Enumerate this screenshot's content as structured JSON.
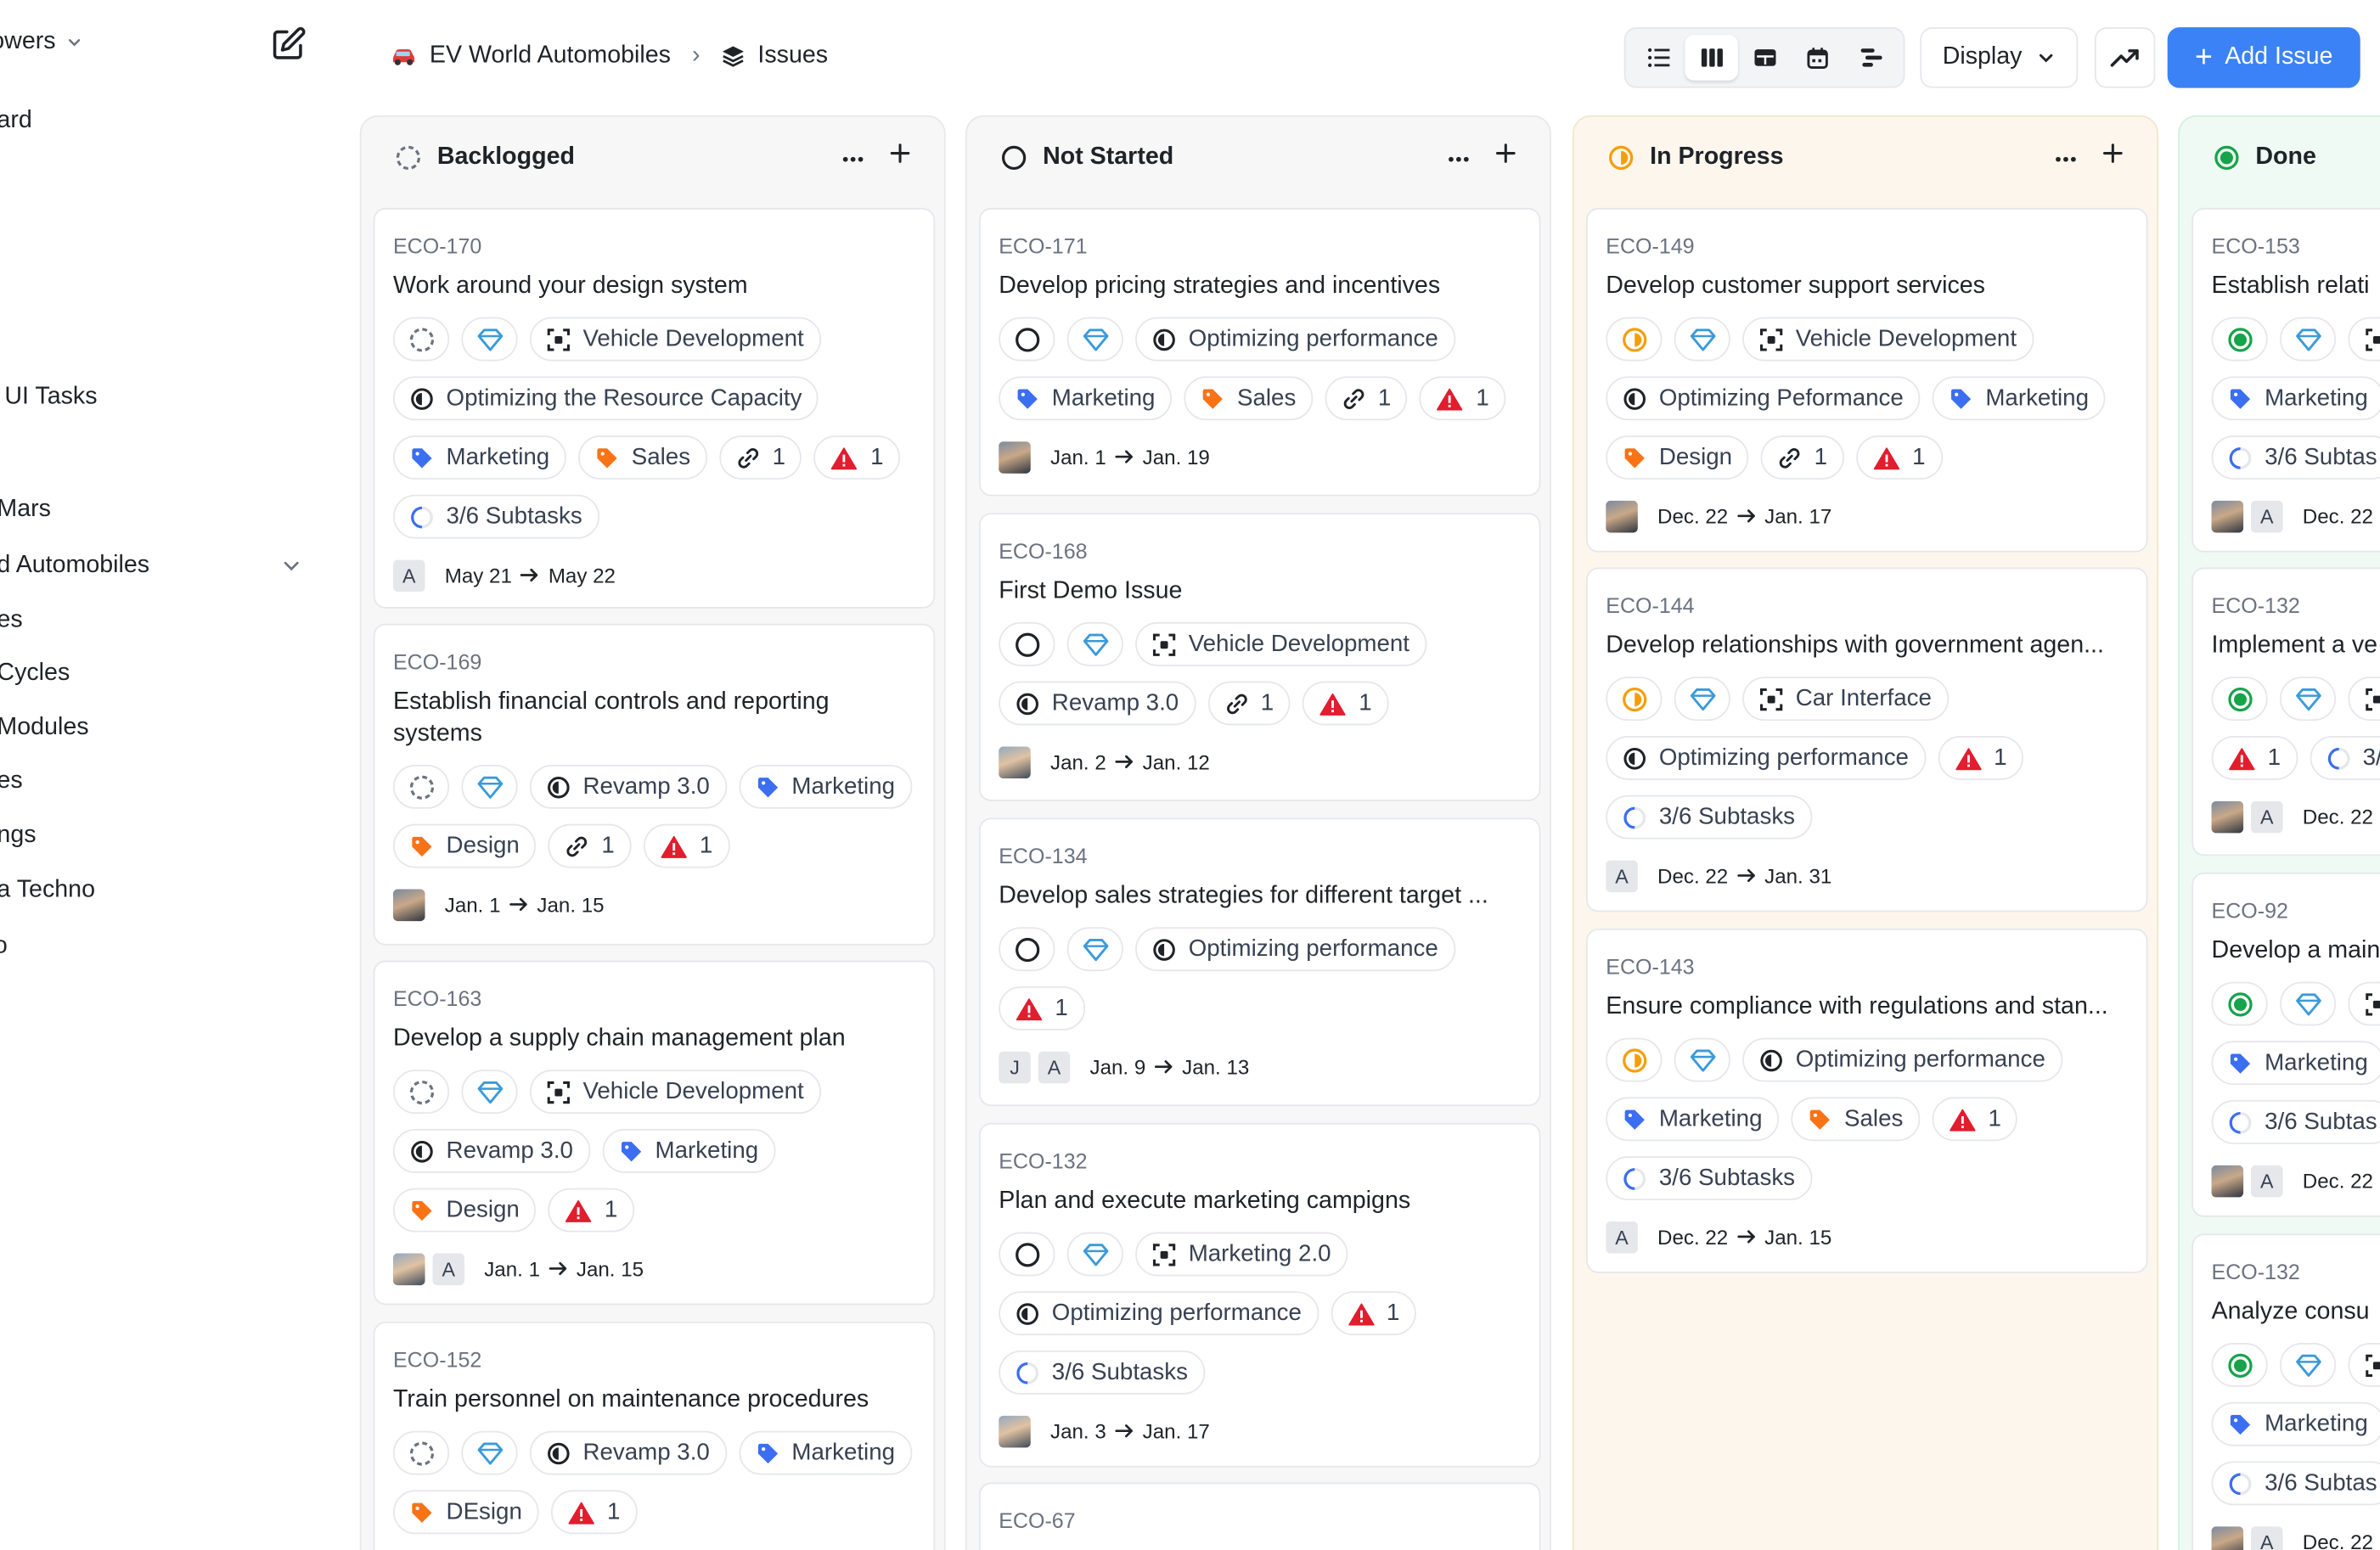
{
  "sidebar": {
    "workspace": "owers",
    "items": [
      "ard",
      "UI Tasks",
      "Mars",
      "d Automobiles",
      "es",
      "Cycles",
      "Modules",
      "es",
      "ngs",
      "a Techno",
      "o"
    ]
  },
  "header": {
    "project": "EV World Automobiles",
    "page": "Issues",
    "display_label": "Display",
    "add_label": "Add Issue",
    "accent_color": "#3b82f6"
  },
  "board": {
    "columns": [
      {
        "title": "Backlogged",
        "status": "backlog",
        "cards": [
          {
            "id": "ECO-170",
            "title": "Work around your design system",
            "rows": [
              [
                {
                  "t": "status"
                },
                {
                  "t": "prio"
                },
                {
                  "t": "module",
                  "l": "Vehicle Development"
                }
              ],
              [
                {
                  "t": "cycle",
                  "l": "Optimizing the Resource Capacity"
                }
              ],
              [
                {
                  "t": "label-blue",
                  "l": "Marketing"
                },
                {
                  "t": "label-orange",
                  "l": "Sales"
                },
                {
                  "t": "link",
                  "l": "1"
                },
                {
                  "t": "alert",
                  "l": "1"
                }
              ],
              [
                {
                  "t": "subtask",
                  "l": "3/6 Subtasks"
                }
              ]
            ],
            "avatars": [
              "A"
            ],
            "date": [
              "May 21",
              "May 22"
            ]
          },
          {
            "id": "ECO-169",
            "title": "Establish financial controls and reporting systems",
            "rows": [
              [
                {
                  "t": "status"
                },
                {
                  "t": "prio"
                },
                {
                  "t": "cycle",
                  "l": "Revamp 3.0"
                },
                {
                  "t": "label-blue",
                  "l": "Marketing"
                }
              ],
              [
                {
                  "t": "label-orange",
                  "l": "Design"
                },
                {
                  "t": "link",
                  "l": "1"
                },
                {
                  "t": "alert",
                  "l": "1"
                }
              ]
            ],
            "avatars": [
              "ph"
            ],
            "date": [
              "Jan. 1",
              "Jan. 15"
            ]
          },
          {
            "id": "ECO-163",
            "title": "Develop a supply chain management plan",
            "rows": [
              [
                {
                  "t": "status"
                },
                {
                  "t": "prio"
                },
                {
                  "t": "module",
                  "l": "Vehicle Development"
                }
              ],
              [
                {
                  "t": "cycle",
                  "l": "Revamp 3.0"
                },
                {
                  "t": "label-blue",
                  "l": "Marketing"
                }
              ],
              [
                {
                  "t": "label-orange",
                  "l": "Design"
                },
                {
                  "t": "alert",
                  "l": "1"
                }
              ]
            ],
            "avatars": [
              "ph2",
              "A"
            ],
            "date": [
              "Jan. 1",
              "Jan. 15"
            ]
          },
          {
            "id": "ECO-152",
            "title": "Train personnel on maintenance procedures",
            "rows": [
              [
                {
                  "t": "status"
                },
                {
                  "t": "prio"
                },
                {
                  "t": "cycle",
                  "l": "Revamp 3.0"
                },
                {
                  "t": "label-blue",
                  "l": "Marketing"
                }
              ],
              [
                {
                  "t": "label-orange",
                  "l": "DEsign"
                },
                {
                  "t": "alert",
                  "l": "1"
                }
              ]
            ],
            "avatars": [],
            "date": null
          }
        ]
      },
      {
        "title": "Not Started",
        "status": "todo",
        "cards": [
          {
            "id": "ECO-171",
            "title": "Develop pricing strategies and incentives",
            "rows": [
              [
                {
                  "t": "status"
                },
                {
                  "t": "prio"
                },
                {
                  "t": "cycle",
                  "l": "Optimizing performance"
                }
              ],
              [
                {
                  "t": "label-blue",
                  "l": "Marketing"
                },
                {
                  "t": "label-orange",
                  "l": "Sales"
                },
                {
                  "t": "link",
                  "l": "1"
                },
                {
                  "t": "alert",
                  "l": "1"
                }
              ]
            ],
            "avatars": [
              "ph"
            ],
            "date": [
              "Jan. 1",
              "Jan. 19"
            ]
          },
          {
            "id": "ECO-168",
            "title": "First Demo Issue",
            "rows": [
              [
                {
                  "t": "status"
                },
                {
                  "t": "prio"
                },
                {
                  "t": "module",
                  "l": "Vehicle Development"
                }
              ],
              [
                {
                  "t": "cycle",
                  "l": "Revamp 3.0"
                },
                {
                  "t": "link",
                  "l": "1"
                },
                {
                  "t": "alert",
                  "l": "1"
                }
              ]
            ],
            "avatars": [
              "ph2"
            ],
            "date": [
              "Jan. 2",
              "Jan. 12"
            ]
          },
          {
            "id": "ECO-134",
            "title": "Develop sales strategies for different target ...",
            "rows": [
              [
                {
                  "t": "status"
                },
                {
                  "t": "prio"
                },
                {
                  "t": "cycle",
                  "l": "Optimizing performance"
                }
              ],
              [
                {
                  "t": "alert",
                  "l": "1"
                }
              ]
            ],
            "avatars": [
              "J",
              "A"
            ],
            "date": [
              "Jan. 9",
              "Jan. 13"
            ]
          },
          {
            "id": "ECO-132",
            "title": "Plan and execute marketing campigns",
            "rows": [
              [
                {
                  "t": "status"
                },
                {
                  "t": "prio"
                },
                {
                  "t": "module",
                  "l": "Marketing 2.0"
                }
              ],
              [
                {
                  "t": "cycle",
                  "l": "Optimizing performance"
                },
                {
                  "t": "alert",
                  "l": "1"
                }
              ],
              [
                {
                  "t": "subtask",
                  "l": "3/6 Subtasks"
                }
              ]
            ],
            "avatars": [
              "ph2"
            ],
            "date": [
              "Jan. 3",
              "Jan. 17"
            ]
          },
          {
            "id": "ECO-67",
            "title": "",
            "rows": [],
            "avatars": [],
            "date": null
          }
        ]
      },
      {
        "title": "In Progress",
        "status": "progress",
        "cards": [
          {
            "id": "ECO-149",
            "title": "Develop customer support services",
            "rows": [
              [
                {
                  "t": "status"
                },
                {
                  "t": "prio"
                },
                {
                  "t": "module",
                  "l": "Vehicle Development"
                }
              ],
              [
                {
                  "t": "cycle",
                  "l": "Optimizing Peformance"
                },
                {
                  "t": "label-blue",
                  "l": "Marketing"
                }
              ],
              [
                {
                  "t": "label-orange",
                  "l": "Design"
                },
                {
                  "t": "link",
                  "l": "1"
                },
                {
                  "t": "alert",
                  "l": "1"
                }
              ]
            ],
            "avatars": [
              "ph"
            ],
            "date": [
              "Dec. 22",
              "Jan. 17"
            ]
          },
          {
            "id": "ECO-144",
            "title": "Develop relationships with government agen...",
            "rows": [
              [
                {
                  "t": "status"
                },
                {
                  "t": "prio"
                },
                {
                  "t": "module",
                  "l": "Car Interface"
                }
              ],
              [
                {
                  "t": "cycle",
                  "l": "Optimizing performance"
                },
                {
                  "t": "alert",
                  "l": "1"
                }
              ],
              [
                {
                  "t": "subtask",
                  "l": "3/6 Subtasks"
                }
              ]
            ],
            "avatars": [
              "A"
            ],
            "date": [
              "Dec. 22",
              "Jan. 31"
            ]
          },
          {
            "id": "ECO-143",
            "title": "Ensure compliance with regulations and stan...",
            "rows": [
              [
                {
                  "t": "status"
                },
                {
                  "t": "prio"
                },
                {
                  "t": "cycle",
                  "l": "Optimizing performance"
                }
              ],
              [
                {
                  "t": "label-blue",
                  "l": "Marketing"
                },
                {
                  "t": "label-orange",
                  "l": "Sales"
                },
                {
                  "t": "alert",
                  "l": "1"
                }
              ],
              [
                {
                  "t": "subtask",
                  "l": "3/6 Subtasks"
                }
              ]
            ],
            "avatars": [
              "A"
            ],
            "date": [
              "Dec. 22",
              "Jan. 15"
            ]
          }
        ]
      },
      {
        "title": "Done",
        "status": "done",
        "cards": [
          {
            "id": "ECO-153",
            "title": "Establish relati",
            "rows": [
              [
                {
                  "t": "status"
                },
                {
                  "t": "prio"
                },
                {
                  "t": "module",
                  "l": ""
                }
              ],
              [
                {
                  "t": "label-blue",
                  "l": "Marketing"
                }
              ],
              [
                {
                  "t": "subtask",
                  "l": "3/6 Subtas"
                }
              ]
            ],
            "avatars": [
              "ph",
              "A"
            ],
            "date": [
              "Dec. 22"
            ]
          },
          {
            "id": "ECO-132",
            "title": "Implement a ve",
            "rows": [
              [
                {
                  "t": "status"
                },
                {
                  "t": "prio"
                },
                {
                  "t": "module",
                  "l": ""
                }
              ],
              [
                {
                  "t": "alert",
                  "l": "1"
                },
                {
                  "t": "subtask",
                  "l": "3/("
                }
              ]
            ],
            "avatars": [
              "ph",
              "A"
            ],
            "date": [
              "Dec. 22"
            ]
          },
          {
            "id": "ECO-92",
            "title": "Develop a main",
            "rows": [
              [
                {
                  "t": "status"
                },
                {
                  "t": "prio"
                },
                {
                  "t": "module",
                  "l": ""
                }
              ],
              [
                {
                  "t": "label-blue",
                  "l": "Marketing"
                }
              ],
              [
                {
                  "t": "subtask",
                  "l": "3/6 Subtas"
                }
              ]
            ],
            "avatars": [
              "ph",
              "A"
            ],
            "date": [
              "Dec. 22"
            ]
          },
          {
            "id": "ECO-132",
            "title": "Analyze consu",
            "rows": [
              [
                {
                  "t": "status"
                },
                {
                  "t": "prio"
                },
                {
                  "t": "module",
                  "l": ""
                }
              ],
              [
                {
                  "t": "label-blue",
                  "l": "Marketing"
                }
              ],
              [
                {
                  "t": "subtask",
                  "l": "3/6 Subtas"
                }
              ]
            ],
            "avatars": [
              "ph",
              "A"
            ],
            "date": [
              "Dec. 22"
            ]
          }
        ]
      }
    ]
  }
}
